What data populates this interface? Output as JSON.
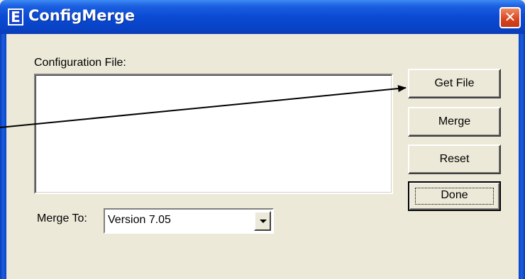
{
  "window": {
    "title": "ConfigMerge",
    "app_icon_letter": "E",
    "close_glyph": "✕"
  },
  "form": {
    "config_label": "Configuration File:",
    "merge_to_label": "Merge To:",
    "merge_to_value": "Version 7.05"
  },
  "buttons": {
    "get_file": "Get File",
    "merge": "Merge",
    "reset": "Reset",
    "done": "Done"
  },
  "icons": {
    "app": "app-e-icon",
    "close": "close-icon",
    "dropdown": "chevron-down-icon",
    "annotation": "annotation-arrow"
  },
  "colors": {
    "titlebar": "#0843C7",
    "dialog_bg": "#ECE9D8",
    "close_button": "#D8431C"
  }
}
